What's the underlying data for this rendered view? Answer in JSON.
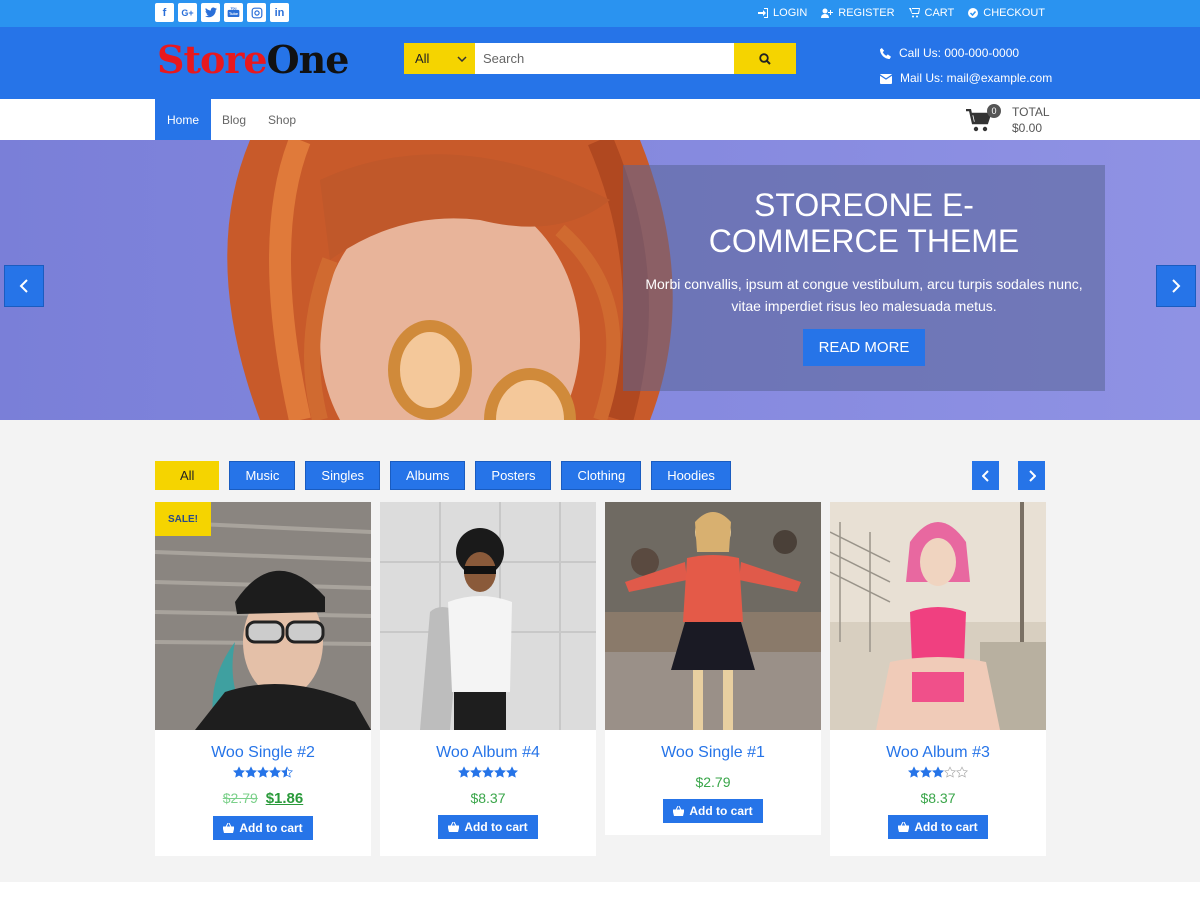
{
  "topbar": {
    "social": [
      {
        "icon": "facebook-icon",
        "glyph": "f"
      },
      {
        "icon": "google-plus-icon",
        "glyph": "G+"
      },
      {
        "icon": "twitter-icon",
        "glyph": "t"
      },
      {
        "icon": "youtube-icon",
        "glyph": "You"
      },
      {
        "icon": "instagram-icon",
        "glyph": "◎"
      },
      {
        "icon": "linkedin-icon",
        "glyph": "in"
      }
    ],
    "login": "LOGIN",
    "register": "REGISTER",
    "cart": "CART",
    "checkout": "CHECKOUT"
  },
  "header": {
    "logo_part1": "Store",
    "logo_part2": "One",
    "search_category": "All",
    "search_placeholder": "Search",
    "phone": "Call Us: 000-000-0000",
    "email": "Mail Us: mail@example.com"
  },
  "nav": {
    "items": [
      "Home",
      "Blog",
      "Shop"
    ],
    "cart_count": "0",
    "total_label": "TOTAL",
    "total_value": "$0.00"
  },
  "hero": {
    "title": "STOREONE E-COMMERCE THEME",
    "description": "Morbi convallis, ipsum at congue vestibulum, arcu turpis sodales nunc, vitae imperdiet risus leo malesuada metus.",
    "button": "READ MORE"
  },
  "filters": [
    "All",
    "Music",
    "Singles",
    "Albums",
    "Posters",
    "Clothing",
    "Hoodies"
  ],
  "products": [
    {
      "name": "Woo Single #2",
      "rating": 4.5,
      "old_price": "$2.79",
      "price": "$1.86",
      "sale": "SALE!",
      "button": "Add to cart"
    },
    {
      "name": "Woo Album #4",
      "rating": 5,
      "price": "$8.37",
      "button": "Add to cart"
    },
    {
      "name": "Woo Single #1",
      "price": "$2.79",
      "button": "Add to cart"
    },
    {
      "name": "Woo Album #3",
      "rating": 3,
      "price": "$8.37",
      "button": "Add to cart"
    }
  ],
  "colors": {
    "primary": "#2674e8",
    "topbar": "#2a93f0",
    "accent": "#f5d400",
    "price": "#3aa64a",
    "logo_red": "#e8181e"
  }
}
